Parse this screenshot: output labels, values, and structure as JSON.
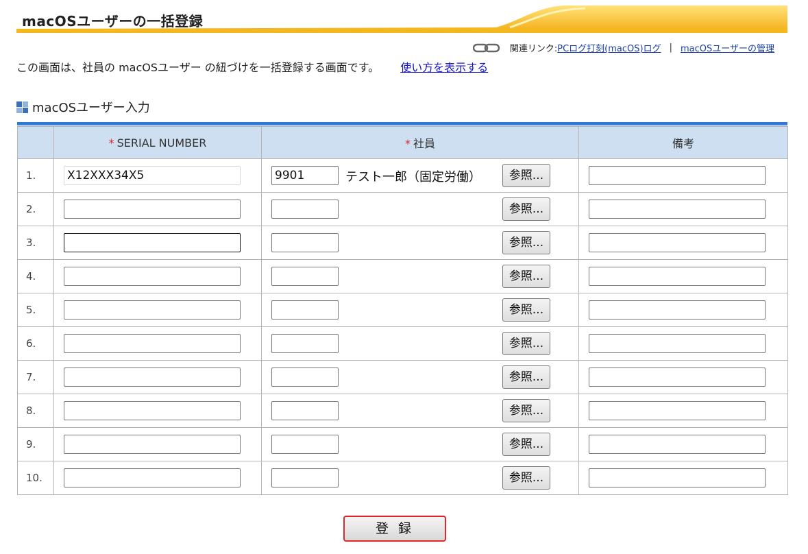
{
  "header": {
    "title": "macOSユーザーの一括登録"
  },
  "related": {
    "label": "関連リンク:",
    "links": [
      "PCログ打刻(macOS)ログ",
      "macOSユーザーの管理"
    ],
    "separator": "|"
  },
  "description": {
    "text": "この画面は、社員の macOSユーザー の紐づけを一括登録する画面です。",
    "help_link": "使い方を表示する"
  },
  "section": {
    "title": "macOSユーザー入力"
  },
  "table": {
    "required_mark": "*",
    "columns": {
      "serial": "SERIAL NUMBER",
      "employee": "社員",
      "note": "備考"
    },
    "reference_label": "参照...",
    "rows": [
      {
        "num": "1.",
        "serial": "X12XXX34X5",
        "emp_code": "9901",
        "emp_name": "テスト一郎（固定労働）",
        "note": ""
      },
      {
        "num": "2.",
        "serial": "",
        "emp_code": "",
        "emp_name": "",
        "note": ""
      },
      {
        "num": "3.",
        "serial": "",
        "emp_code": "",
        "emp_name": "",
        "note": ""
      },
      {
        "num": "4.",
        "serial": "",
        "emp_code": "",
        "emp_name": "",
        "note": ""
      },
      {
        "num": "5.",
        "serial": "",
        "emp_code": "",
        "emp_name": "",
        "note": ""
      },
      {
        "num": "6.",
        "serial": "",
        "emp_code": "",
        "emp_name": "",
        "note": ""
      },
      {
        "num": "7.",
        "serial": "",
        "emp_code": "",
        "emp_name": "",
        "note": ""
      },
      {
        "num": "8.",
        "serial": "",
        "emp_code": "",
        "emp_name": "",
        "note": ""
      },
      {
        "num": "9.",
        "serial": "",
        "emp_code": "",
        "emp_name": "",
        "note": ""
      },
      {
        "num": "10.",
        "serial": "",
        "emp_code": "",
        "emp_name": "",
        "note": ""
      }
    ]
  },
  "submit": {
    "label": "登 録"
  },
  "colors": {
    "header_accent": "#f5b81c",
    "table_header_bg": "#cfdff2",
    "table_top_rule": "#2f78d2",
    "required": "#e0262b",
    "link": "#1a3fa8",
    "submit_border": "#e0262b"
  },
  "icons": {
    "related": "chain-link-icon",
    "section": "grid-squares-icon"
  }
}
